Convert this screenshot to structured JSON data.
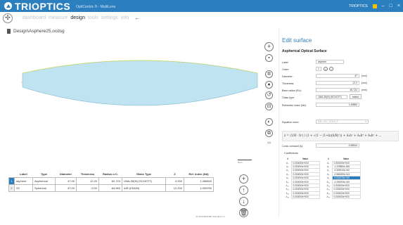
{
  "titlebar": {
    "brand": "TRIOPTICS",
    "subtitle": "OptiCentric ® - MultiLens",
    "user": "TRIOPTICS",
    "accent": "#2c7fbf"
  },
  "nav": {
    "items": [
      "dashboard",
      "measure",
      "design",
      "tools",
      "settings",
      "info"
    ],
    "active_index": 2,
    "back_icon": "arrow-left-icon"
  },
  "file": {
    "path": "Design\\Asphere25.ocdsg"
  },
  "scale": {
    "label": "5mm"
  },
  "table": {
    "headers": [
      "Label",
      "Type",
      "Diameter",
      "Thickness",
      "Radius o.C.",
      "Glass Type",
      "Z",
      "Ref. Index (Nd)"
    ],
    "rows": [
      {
        "num": "1",
        "label": "asphere",
        "type": "Aspherical",
        "diameter": "47.00",
        "thickness": "12.20",
        "radius": "60.724",
        "glass": "LBAL35(N) (SCHOTT)",
        "z": "0.000",
        "ref": "1.458840"
      },
      {
        "num": "2",
        "label": "S2",
        "type": "Spherical",
        "diameter": "47.00",
        "thickness": "0.00",
        "radius": "-84.563",
        "glass": "AIR (KNUM)",
        "z": "12.200",
        "ref": "1.000290"
      }
    ],
    "selected_row": 0
  },
  "footnote": "Air (KNUM/AFRE VALUES) nm",
  "right_panel": {
    "title": "Edit surface",
    "heading": "Aspherical Optical Surface",
    "fields": {
      "label": {
        "label": "Label",
        "value": "asphere"
      },
      "order": {
        "label": "Order:",
        "value": "1"
      },
      "diameter": {
        "label": "Diameter:",
        "value": "47",
        "unit": "[mm]"
      },
      "thickness": {
        "label": "Thickness:",
        "value": "12.2",
        "unit": "[mm]"
      },
      "base_radius": {
        "label": "Base radius (Rc):",
        "value": "60.724",
        "unit": "[mm]"
      },
      "glass_type": {
        "label": "Glass type:",
        "value": "LBAL35(N) (SCHOTT)",
        "button": "select"
      },
      "refractive_index": {
        "label": "Refractive index (Nd):",
        "value": "1.45884"
      },
      "equation_norm": {
        "label": "Equation norm:",
        "value": "DIN_ISO_10110_E"
      },
      "conic_constant": {
        "label": "Conic constant (k):",
        "value": "-0.65944"
      }
    },
    "equation": "z = (1/R · h²) / (1 + √(1 − (1+k)(h/R)²)) + A₂h² + A₄h⁴ + A₆h⁶ + ...",
    "coefficients": {
      "title": "Coefficients",
      "headers": [
        "#",
        "Value",
        "#",
        "Value"
      ],
      "rows": [
        [
          "A₀",
          "0.000000e+000",
          "A₁",
          "0.000000e+000"
        ],
        [
          "A₂",
          "0.000000e+000",
          "A₃",
          "-1.225580e-006"
        ],
        [
          "A₄",
          "0.000000e+000",
          "A₅",
          "-3.452910e-010"
        ],
        [
          "A₆",
          "0.000000e+000",
          "A₇",
          "-2.584089e-013"
        ],
        [
          "A₈",
          "0.000000e+000",
          "A₉",
          "-5.004278e-016"
        ],
        [
          "A₁₀",
          "0.000000e+000",
          "A₁₁",
          "-4.282093e-019"
        ],
        [
          "A₁₂",
          "0.000000e+000",
          "A₁₃",
          "0.000000e+000"
        ],
        [
          "A₁₄",
          "0.000000e+000",
          "A₁₅",
          "0.000000e+000"
        ],
        [
          "A₁₆",
          "0.000000e+000",
          "A₁₇",
          "0.000000e+000"
        ],
        [
          "A₁₈",
          "0.000000e+000",
          "A₁₉",
          "0.000000e+000"
        ]
      ],
      "highlight_row": 4
    }
  },
  "icons": {
    "middle_toolbar": [
      "plus-icon",
      "trash-icon",
      "gear-icon",
      "camera-icon",
      "undo-icon",
      "import-icon",
      "lens-icon",
      "copy-icon",
      "link-icon"
    ],
    "table_actions": [
      "plus-icon",
      "arrow-up-icon",
      "arrow-down-icon",
      "trash-icon"
    ]
  }
}
